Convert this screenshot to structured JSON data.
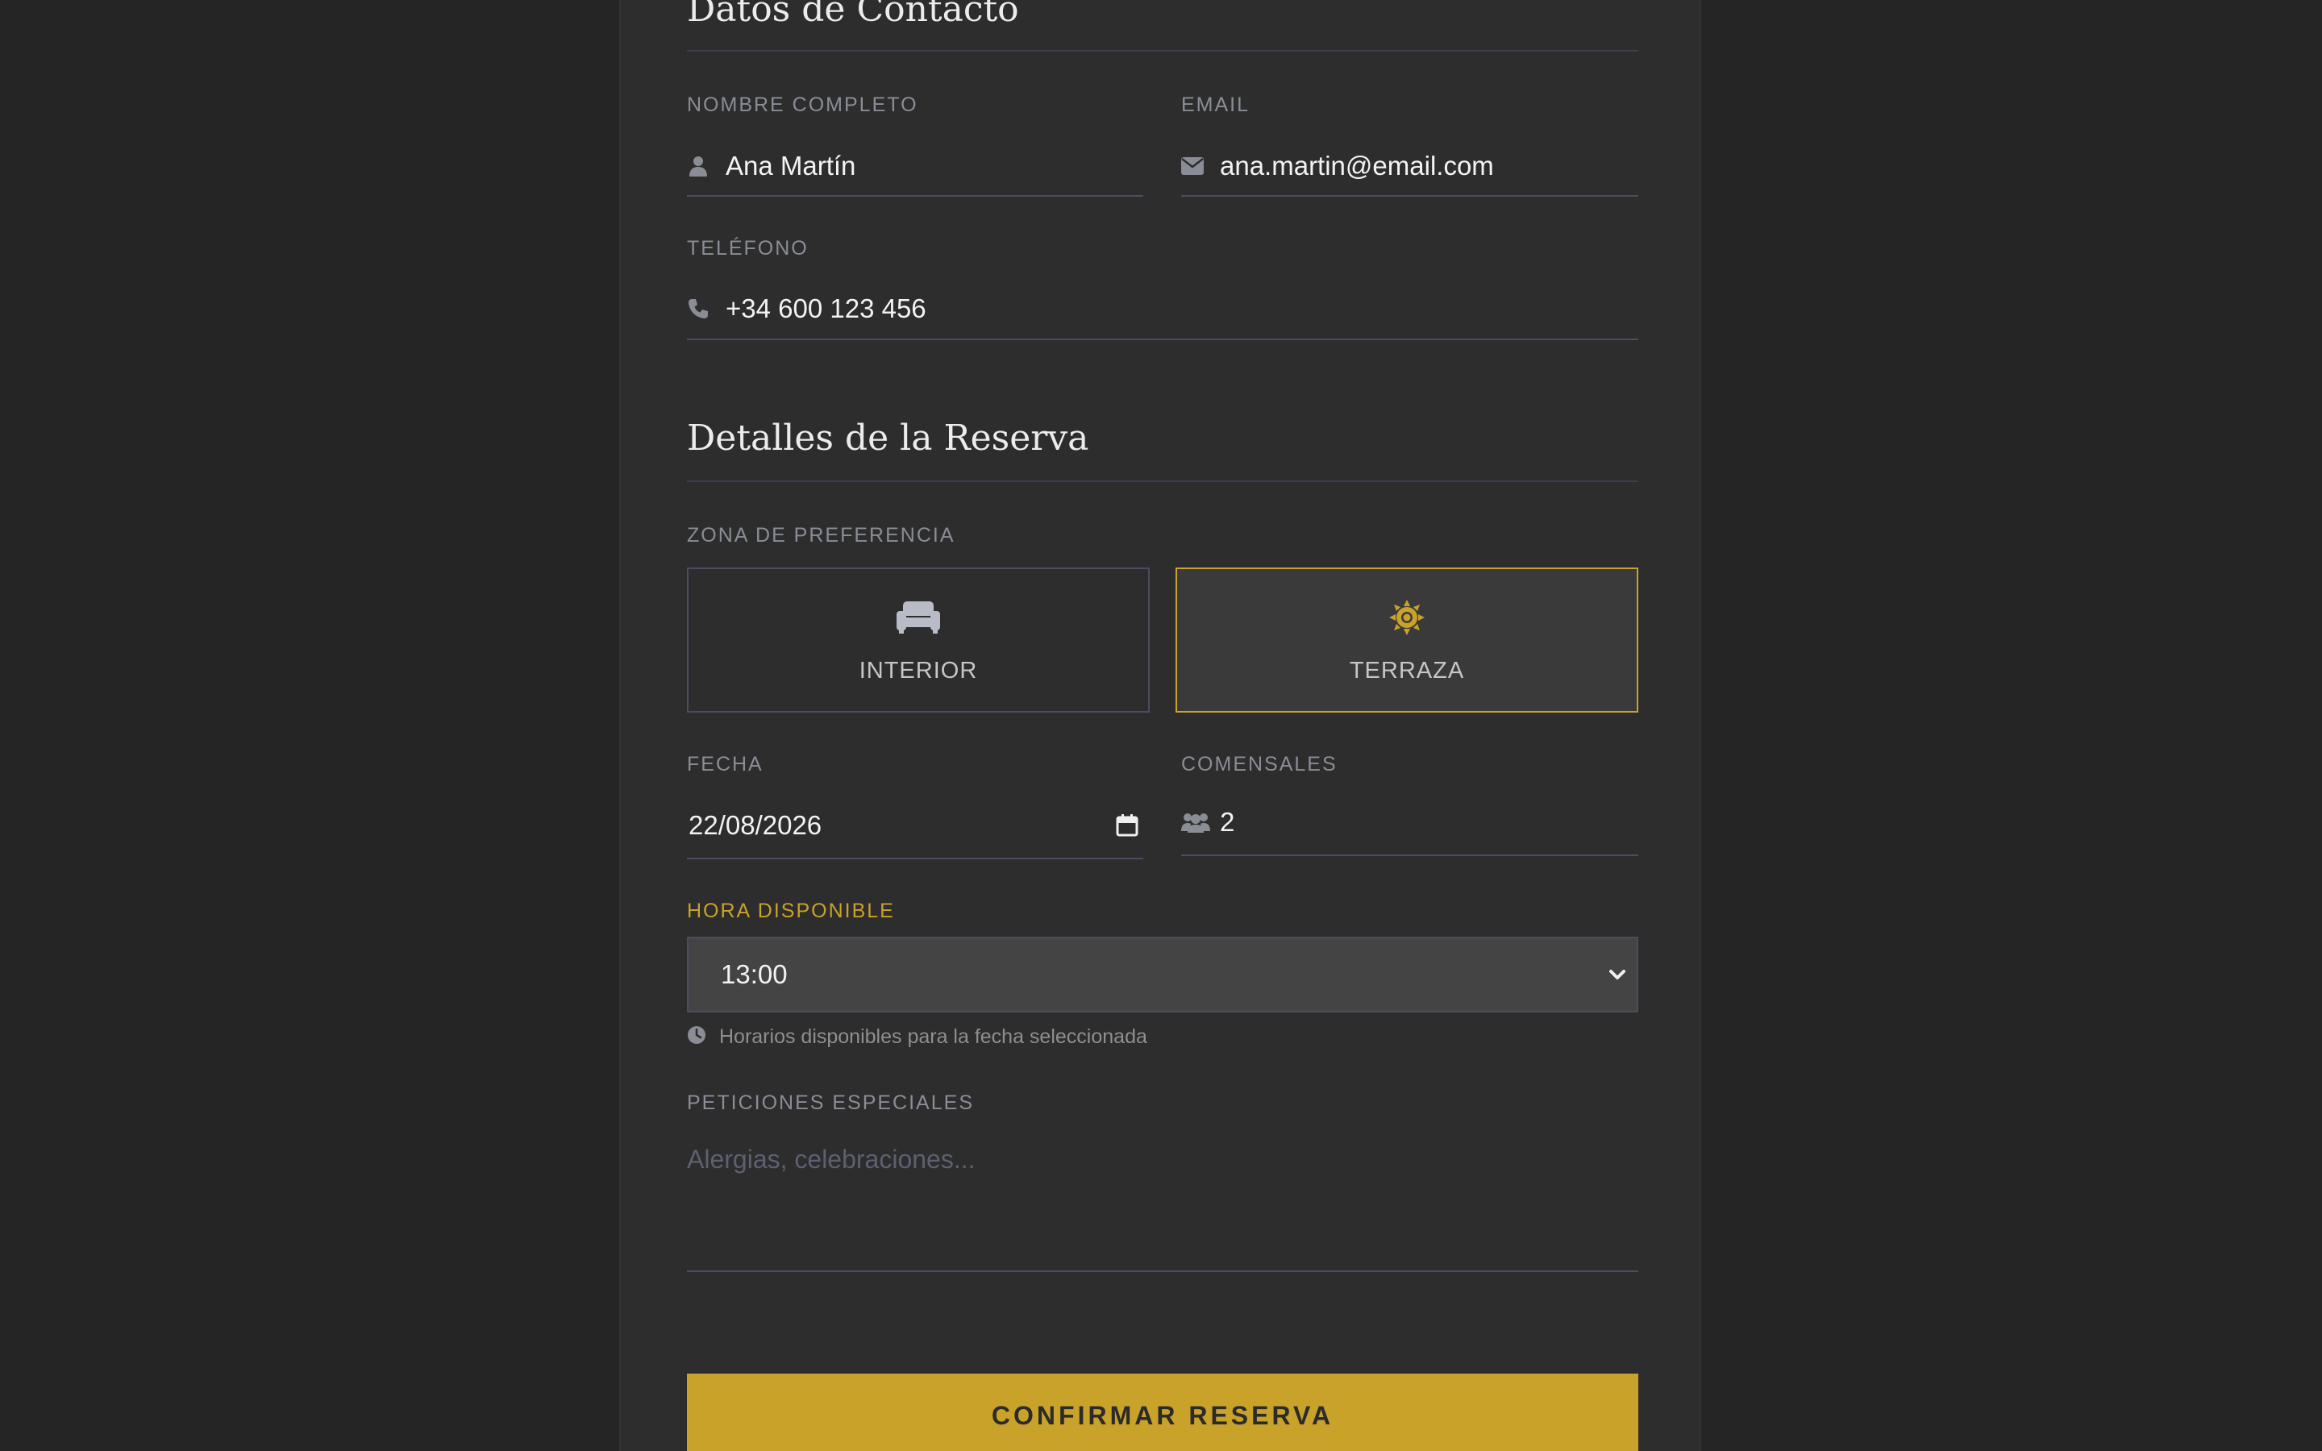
{
  "contact": {
    "title": "Datos de Contacto",
    "name": {
      "label": "NOMBRE COMPLETO",
      "value": "Ana Martín",
      "icon": "user-icon"
    },
    "email": {
      "label": "EMAIL",
      "value": "ana.martin@email.com",
      "icon": "envelope-icon"
    },
    "phone": {
      "label": "TELÉFONO",
      "value": "+34 600 123 456",
      "icon": "phone-icon"
    }
  },
  "reservation": {
    "title": "Detalles de la Reserva",
    "zone": {
      "label": "ZONA DE PREFERENCIA",
      "options": [
        {
          "label": "INTERIOR",
          "icon": "couch-icon",
          "selected": false
        },
        {
          "label": "TERRAZA",
          "icon": "sun-icon",
          "selected": true
        }
      ]
    },
    "date": {
      "label": "FECHA",
      "value": "22/08/2026",
      "icon": "calendar-icon"
    },
    "guests": {
      "label": "COMENSALES",
      "value": "2",
      "icon": "users-icon"
    },
    "time": {
      "label": "HORA DISPONIBLE",
      "value": "13:00",
      "hint": "Horarios disponibles para la fecha seleccionada",
      "hint_icon": "clock-icon"
    },
    "requests": {
      "label": "PETICIONES ESPECIALES",
      "placeholder": "Alergias, celebraciones..."
    }
  },
  "submit": {
    "label": "CONFIRMAR RESERVA"
  },
  "colors": {
    "background": "#252525",
    "card": "#2d2d2d",
    "accent": "#c9a229",
    "field_border": "#4a4d60",
    "label": "#8b8d96",
    "text": "#f3f3f3",
    "placeholder": "#5c6070"
  }
}
